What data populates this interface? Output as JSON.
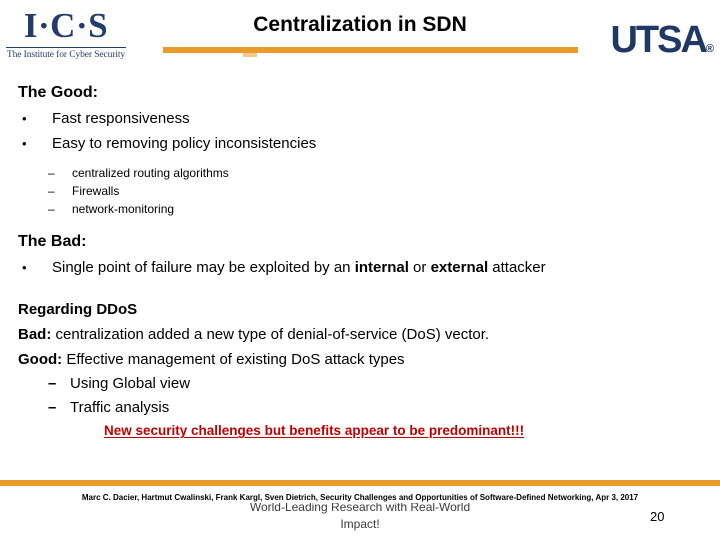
{
  "header": {
    "ics_logo": {
      "mark": "I·C·S",
      "tagline": "The Institute for Cyber Security"
    },
    "title": "Centralization in SDN",
    "utsa_logo": {
      "text": "UTSA",
      "registered": "®"
    },
    "accent_color": "#eb9b2b",
    "navy_color": "#1f3864"
  },
  "body": {
    "good_heading": "The Good:",
    "good_bullets": [
      "Fast responsiveness",
      "Easy to removing policy inconsistencies"
    ],
    "good_sub_bullets": [
      "centralized routing algorithms",
      "Firewalls",
      "network-monitoring"
    ],
    "bad_heading": "The Bad:",
    "bad_bullet": {
      "pre": "Single point of failure may be exploited by an ",
      "bold1": "internal",
      "mid": " or ",
      "bold2": "external",
      "post": " attacker"
    },
    "ddos_heading": "Regarding DDoS",
    "ddos_bad": {
      "label": "Bad:",
      "text": " centralization added a new type of denial-of-service (DoS) vector."
    },
    "ddos_good": {
      "label": "Good:",
      "text": " Effective management of existing DoS attack types"
    },
    "ddos_sub_bullets": [
      "Using Global view",
      "Traffic analysis"
    ],
    "conclusion": "New security challenges but benefits appear to be predominant!!!",
    "conclusion_color": "#c00000",
    "bullet_glyph": "•",
    "dash_glyph": "–"
  },
  "footer": {
    "citation": "Marc C. Dacier, Hartmut Cwalinski, Frank Kargl, Sven Dietrich, Security Challenges and Opportunities of Software-Defined Networking, Apr 3, 2017",
    "tagline_line1": "World-Leading Research with Real-World",
    "tagline_line2": "Impact!",
    "slide_number": "20"
  }
}
